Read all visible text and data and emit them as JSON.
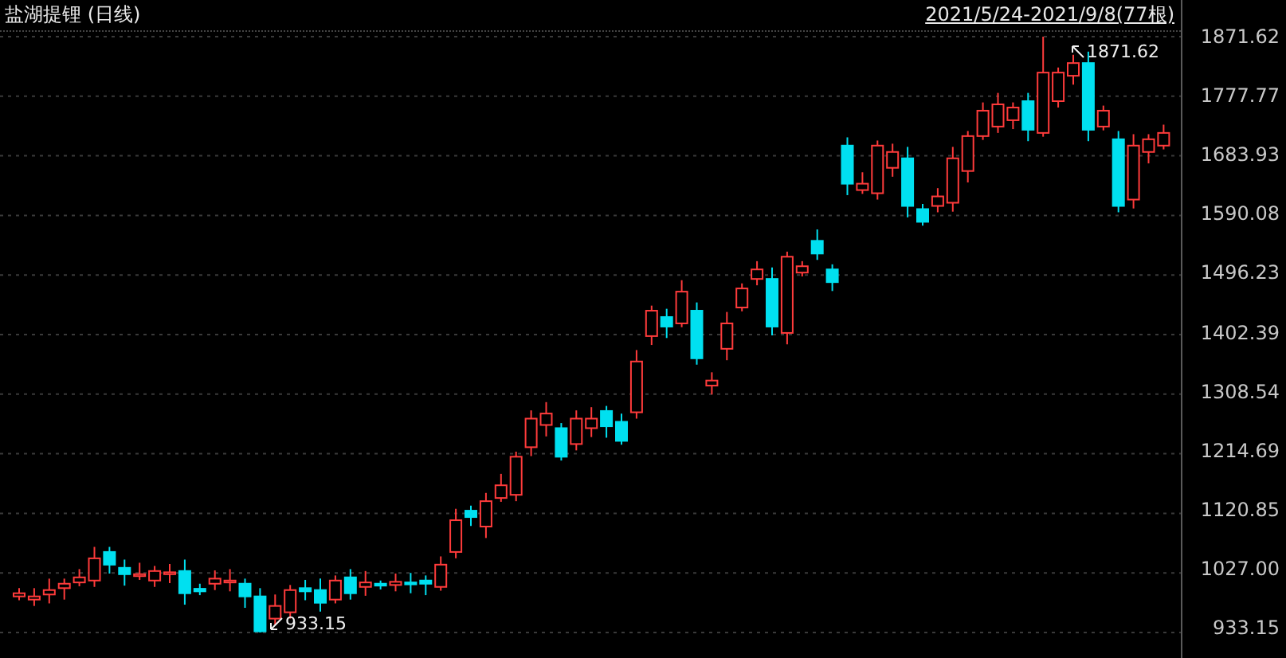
{
  "chart": {
    "title": "盐湖提锂 (日线)",
    "date_range": "2021/5/24-2021/9/8(77根)",
    "high_marker": "1871.62",
    "low_marker": "933.15",
    "chart_data": {
      "type": "candlestick",
      "grid": true,
      "ylim": [
        893,
        1879.15
      ],
      "ohlc": [
        [
          990,
          1003,
          984,
          995
        ],
        [
          985,
          1003,
          975,
          990
        ],
        [
          993,
          1018,
          979,
          1000
        ],
        [
          1003,
          1018,
          985,
          1010
        ],
        [
          1012,
          1033,
          1006,
          1020
        ],
        [
          1015,
          1068,
          1005,
          1050
        ],
        [
          1060,
          1068,
          1026,
          1040
        ],
        [
          1035,
          1048,
          1007,
          1025
        ],
        [
          1022,
          1043,
          1016,
          1025
        ],
        [
          1015,
          1038,
          1005,
          1030
        ],
        [
          1025,
          1041,
          1011,
          1028
        ],
        [
          1030,
          1048,
          977,
          995
        ],
        [
          1002,
          1010,
          992,
          998
        ],
        [
          1010,
          1031,
          1000,
          1018
        ],
        [
          1012,
          1033,
          998,
          1015
        ],
        [
          1010,
          1018,
          972,
          990
        ],
        [
          990,
          1003,
          933.15,
          935
        ],
        [
          955,
          993,
          945,
          975
        ],
        [
          965,
          1008,
          955,
          1000
        ],
        [
          1003,
          1016,
          984,
          998
        ],
        [
          1000,
          1018,
          966,
          980
        ],
        [
          985,
          1023,
          979,
          1015
        ],
        [
          1020,
          1033,
          985,
          995
        ],
        [
          1005,
          1030,
          991,
          1012
        ],
        [
          1010,
          1015,
          1001,
          1007
        ],
        [
          1008,
          1026,
          998,
          1013
        ],
        [
          1012,
          1027,
          995,
          1009
        ],
        [
          1015,
          1023,
          992,
          1010
        ],
        [
          1005,
          1053,
          999,
          1040
        ],
        [
          1060,
          1128,
          1050,
          1110
        ],
        [
          1125,
          1133,
          1101,
          1115
        ],
        [
          1100,
          1153,
          1082,
          1140
        ],
        [
          1145,
          1183,
          1139,
          1165
        ],
        [
          1150,
          1218,
          1140,
          1210
        ],
        [
          1225,
          1283,
          1211,
          1270
        ],
        [
          1260,
          1296,
          1242,
          1278
        ],
        [
          1255,
          1263,
          1204,
          1210
        ],
        [
          1230,
          1283,
          1220,
          1270
        ],
        [
          1255,
          1288,
          1241,
          1270
        ],
        [
          1282,
          1290,
          1240,
          1258
        ],
        [
          1265,
          1278,
          1229,
          1235
        ],
        [
          1280,
          1378,
          1270,
          1360
        ],
        [
          1400,
          1448,
          1386,
          1440
        ],
        [
          1430,
          1443,
          1397,
          1415
        ],
        [
          1420,
          1488,
          1414,
          1470
        ],
        [
          1440,
          1453,
          1355,
          1365
        ],
        [
          1322,
          1343,
          1308,
          1330
        ],
        [
          1380,
          1438,
          1362,
          1420
        ],
        [
          1445,
          1483,
          1439,
          1475
        ],
        [
          1490,
          1518,
          1480,
          1505
        ],
        [
          1490,
          1508,
          1401,
          1415
        ],
        [
          1405,
          1533,
          1387,
          1525
        ],
        [
          1500,
          1518,
          1494,
          1510
        ],
        [
          1550,
          1568,
          1520,
          1530
        ],
        [
          1505,
          1513,
          1471,
          1485
        ],
        [
          1700,
          1713,
          1622,
          1640
        ],
        [
          1630,
          1658,
          1624,
          1640
        ],
        [
          1625,
          1708,
          1615,
          1700
        ],
        [
          1665,
          1703,
          1651,
          1690
        ],
        [
          1680,
          1698,
          1587,
          1605
        ],
        [
          1600,
          1608,
          1574,
          1580
        ],
        [
          1605,
          1633,
          1595,
          1620
        ],
        [
          1610,
          1698,
          1596,
          1680
        ],
        [
          1660,
          1723,
          1642,
          1715
        ],
        [
          1715,
          1768,
          1709,
          1755
        ],
        [
          1730,
          1783,
          1720,
          1765
        ],
        [
          1740,
          1768,
          1726,
          1760
        ],
        [
          1770,
          1783,
          1707,
          1725
        ],
        [
          1720,
          1871.62,
          1714,
          1815
        ],
        [
          1770,
          1823,
          1760,
          1815
        ],
        [
          1810,
          1843,
          1796,
          1830
        ],
        [
          1830,
          1848,
          1707,
          1725
        ],
        [
          1730,
          1763,
          1724,
          1755
        ],
        [
          1710,
          1723,
          1595,
          1605
        ],
        [
          1615,
          1718,
          1601,
          1700
        ],
        [
          1690,
          1718,
          1672,
          1710
        ],
        [
          1700,
          1733,
          1694,
          1720
        ]
      ],
      "yticks": [
        {
          "value": 1871.62,
          "label": "1871.62"
        },
        {
          "value": 1777.77,
          "label": "1777.77"
        },
        {
          "value": 1683.93,
          "label": "1683.93"
        },
        {
          "value": 1590.08,
          "label": "1590.08"
        },
        {
          "value": 1496.23,
          "label": "1496.23"
        },
        {
          "value": 1402.39,
          "label": "1402.39"
        },
        {
          "value": 1308.54,
          "label": "1308.54"
        },
        {
          "value": 1214.69,
          "label": "1214.69"
        },
        {
          "value": 1120.85,
          "label": "1120.85"
        },
        {
          "value": 1027,
          "label": "1027.00"
        },
        {
          "value": 933.15,
          "label": "933.15"
        }
      ]
    }
  }
}
